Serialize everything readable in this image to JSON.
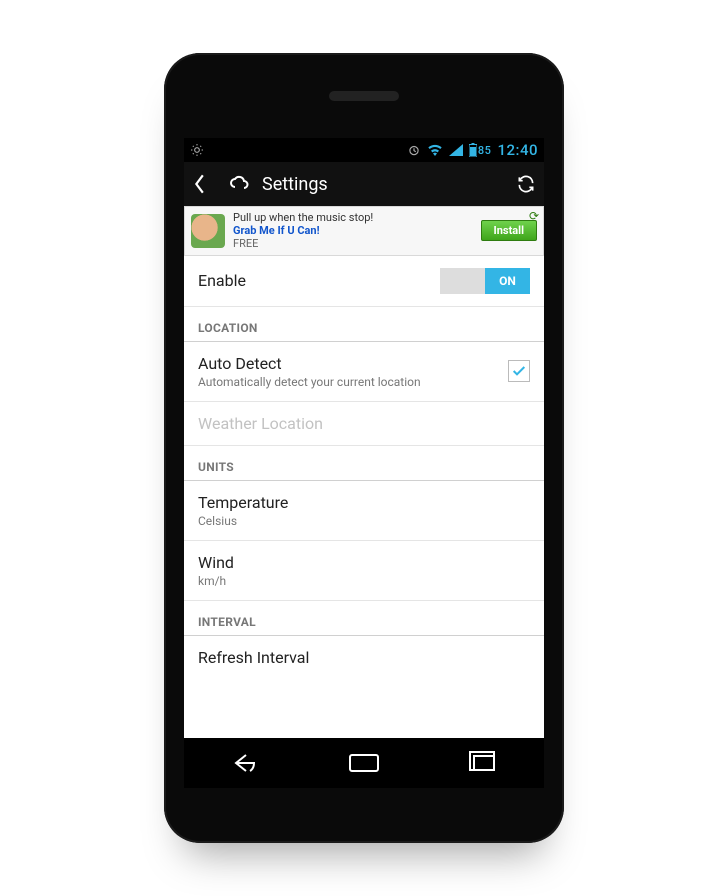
{
  "statusbar": {
    "battery": "85",
    "time": "12:40"
  },
  "actionbar": {
    "title": "Settings"
  },
  "ad": {
    "line1": "Pull up when the music stop!",
    "line2": "Grab Me If U Can!",
    "line3": "FREE",
    "button": "Install"
  },
  "rows": {
    "enable_label": "Enable",
    "enable_toggle": "ON",
    "section_location": "LOCATION",
    "auto_detect_title": "Auto Detect",
    "auto_detect_sub": "Automatically detect your current location",
    "weather_location": "Weather Location",
    "section_units": "UNITS",
    "temperature_title": "Temperature",
    "temperature_sub": "Celsius",
    "wind_title": "Wind",
    "wind_sub": "km/h",
    "section_interval": "INTERVAL",
    "refresh_interval": "Refresh Interval"
  }
}
